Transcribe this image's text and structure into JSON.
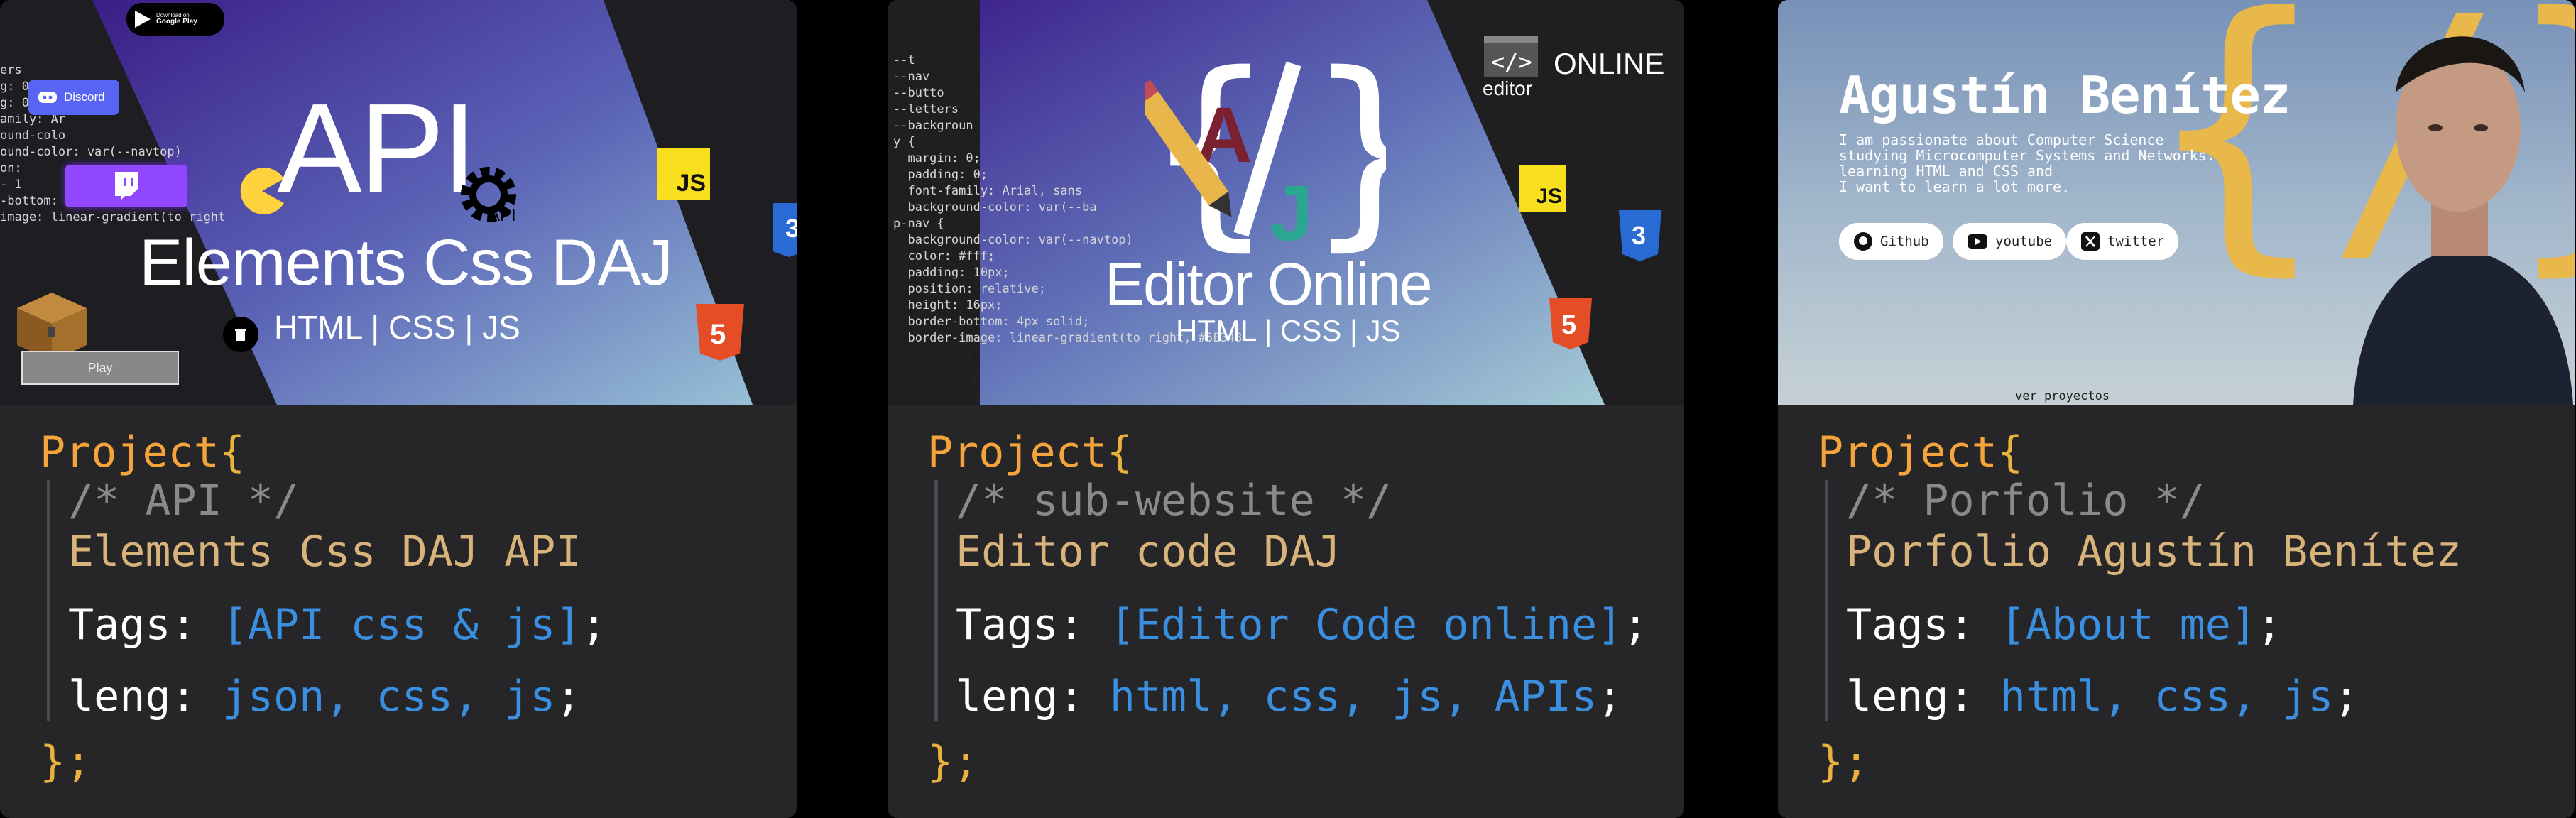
{
  "cards": [
    {
      "thumb": {
        "title": "API",
        "subtitle": "Elements Css DAJ",
        "tech": "HTML | CSS | JS",
        "gear_label": "API",
        "play_label": "Play",
        "discord_label": "Discord",
        "store_small": "Download on",
        "store_large": "Google Play",
        "js_badge": "JS",
        "code_lines": [
          "ers",
          "g: 0;",
          "g: 0;",
          "amily: Ar",
          "ound-colo",
          "",
          "",
          "ound-color: var(--navtop)",
          "",
          "on:",
          "- 1",
          "-bottom: 4px solid;",
          "image: linear-gradient(to right"
        ]
      },
      "code": {
        "open": "Project",
        "comment": "/* API */",
        "name": "Elements Css DAJ API",
        "tags_key": "Tags:",
        "tags_value": "[API css & js]",
        "leng_key": "leng:",
        "leng_value": "json, css, js",
        "close": "};"
      }
    },
    {
      "thumb": {
        "title": "Editor Online",
        "tech": "HTML | CSS | JS",
        "brand_small": "editor",
        "brand_large": "ONLINE",
        "js_badge": "JS",
        "code_lines": [
          "--t",
          "--nav",
          "--butto",
          "--letters",
          "--backgroun",
          "",
          "",
          "y {",
          "  margin: 0;",
          "  padding: 0;",
          "  font-family: Arial, sans",
          "  background-color: var(--ba",
          "",
          "",
          "p-nav {",
          "  background-color: var(--navtop)",
          "  color: #fff;",
          "  padding: 10px;",
          "",
          "  position: relative;",
          "  height: 16px;",
          "  border-bottom: 4px solid;",
          "  border-image: linear-gradient(to right, #5E348"
        ]
      },
      "code": {
        "open": "Project",
        "comment": "/* sub-website */",
        "name": "Editor code DAJ",
        "tags_key": "Tags:",
        "tags_value": "[Editor Code online]",
        "leng_key": "leng:",
        "leng_value": "html, css, js, APIs",
        "close": "};"
      }
    },
    {
      "thumb": {
        "name": "Agustín Benítez",
        "bio": [
          "I am passionate about Computer Science",
          "studying Microcomputer Systems and Networks.",
          "learning HTML and CSS and",
          "I want to learn a lot more."
        ],
        "buttons": [
          "Github",
          "youtube",
          "twitter"
        ],
        "projects_link": "ver proyectos"
      },
      "code": {
        "open": "Project",
        "comment": "/* Porfolio */",
        "name": "Porfolio Agustín Benítez",
        "tags_key": "Tags:",
        "tags_value": "[About me]",
        "leng_key": "leng:",
        "leng_value": "html, css, js",
        "close": "};"
      }
    }
  ],
  "colors": {
    "card_bg": "#262629",
    "keyword": "#f5a33b",
    "comment": "#8a8a8a",
    "name": "#d8b37a",
    "value": "#3a8fe0",
    "js_yellow": "#f7df1e",
    "css_blue": "#2a6ad5",
    "html_orange": "#e44d26"
  },
  "icons": [
    "google-play-icon",
    "discord-icon",
    "twitch-icon",
    "pacman-icon",
    "gear-icon",
    "trash-icon",
    "minecraft-chest-icon",
    "js-logo-icon",
    "css3-logo-icon",
    "html5-logo-icon",
    "editor-logo-icon",
    "code-brackets-icon",
    "pencil-icon",
    "github-icon",
    "youtube-icon",
    "x-twitter-icon"
  ]
}
